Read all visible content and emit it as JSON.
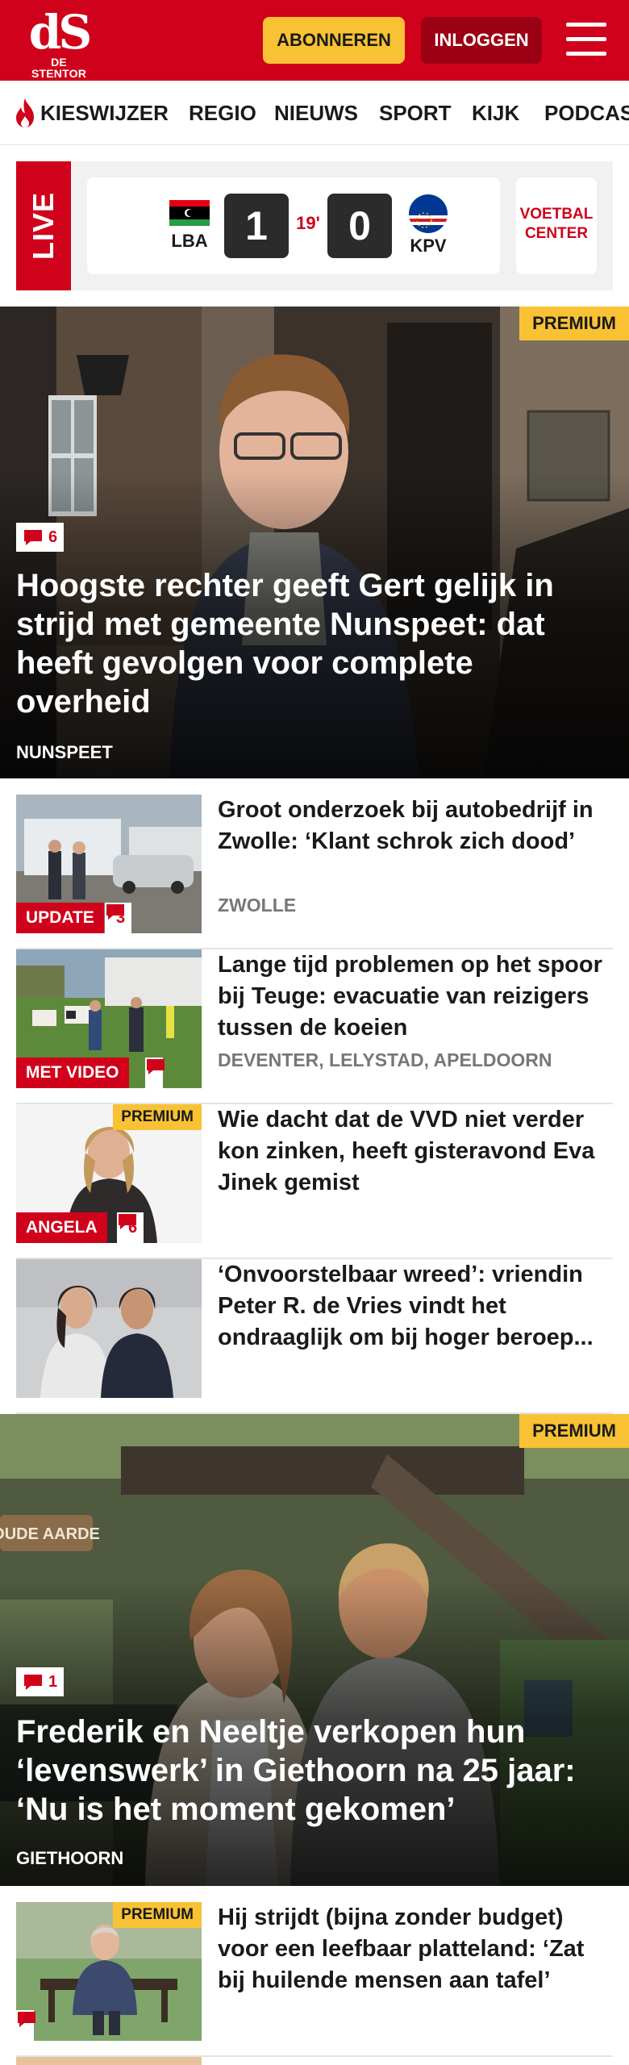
{
  "header": {
    "logo_mark": "dS",
    "logo_text": "DE STENTOR",
    "subscribe_label": "ABONNEREN",
    "login_label": "INLOGGEN",
    "menu_icon": "hamburger-icon",
    "brand_color": "#d0021b",
    "accent_color": "#f9c235"
  },
  "nav": {
    "items": [
      {
        "label": "KIESWIJZER",
        "icon": "flame-icon"
      },
      {
        "label": "REGIO"
      },
      {
        "label": "NIEUWS"
      },
      {
        "label": "SPORT"
      },
      {
        "label": "KIJK"
      },
      {
        "label": "PODCAS"
      }
    ]
  },
  "live": {
    "label": "LIVE",
    "home_team": "LBA",
    "away_team": "KPV",
    "home_score": "1",
    "away_score": "0",
    "minute": "19'",
    "voetbal_center": "VOETBAL CENTER"
  },
  "hero1": {
    "premium": "PREMIUM",
    "comments": "6",
    "title": "Hoogste rechter geeft Gert gelijk in strijd met gemeente Nunspeet: dat heeft gevolgen voor complete overheid",
    "location": "NUNSPEET"
  },
  "articles": [
    {
      "title": "Groot onderzoek bij autobedrijf in Zwolle: ‘Klant schrok zich dood’",
      "location": "ZWOLLE",
      "label": "UPDATE",
      "comments": "3"
    },
    {
      "title": "Lange tijd problemen op het spoor bij Teuge: evacuatie van reizigers tussen de koeien",
      "location": "DEVENTER, LELYSTAD, APELDOORN",
      "label": "MET VIDEO",
      "comments": ""
    },
    {
      "title": "Wie dacht dat de VVD niet verder kon zinken, heeft gisteravond Eva Jinek gemist",
      "label": "ANGELA",
      "comments": "6",
      "premium": "PREMIUM"
    },
    {
      "title": "‘Onvoorstelbaar wreed’: vriendin Peter R. de Vries vindt het ondraaglijk om bij hoger beroep..."
    }
  ],
  "hero2": {
    "premium": "PREMIUM",
    "comments": "1",
    "sign_text": "OUDE AARDE",
    "title": "Frederik en Neeltje verkopen hun ‘levenswerk’ in Giethoorn na 25 jaar: ‘Nu is het moment gekomen’",
    "location": "GIETHOORN"
  },
  "article5": {
    "title": "Hij strijdt (bijna zonder budget) voor een leefbaar platteland: ‘Zat bij huilende mensen aan tafel’",
    "premium": "PREMIUM",
    "comments": ""
  }
}
